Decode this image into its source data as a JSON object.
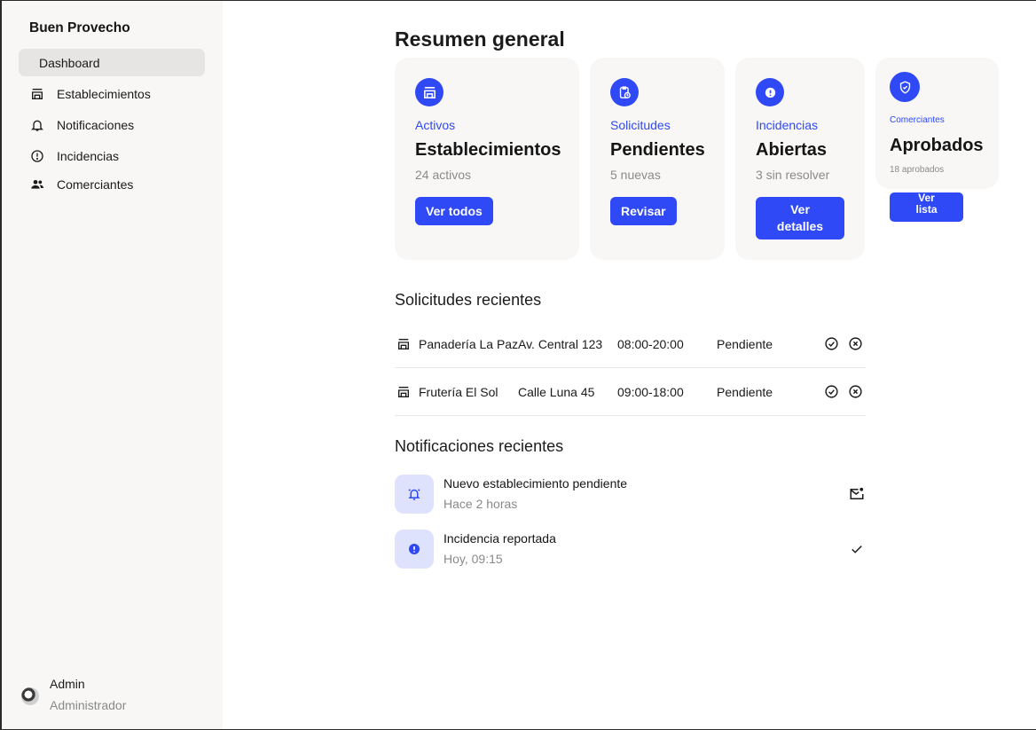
{
  "sidebar": {
    "brand": "Buen Provecho",
    "items": [
      {
        "label": "Dashboard",
        "icon": "none"
      },
      {
        "label": "Establecimientos",
        "icon": "storefront-icon"
      },
      {
        "label": "Notificaciones",
        "icon": "bell-icon"
      },
      {
        "label": "Incidencias",
        "icon": "alert-circle-icon"
      },
      {
        "label": "Comerciantes",
        "icon": "people-icon"
      }
    ],
    "user": {
      "name": "Admin",
      "role": "Administrador"
    }
  },
  "main": {
    "title": "Resumen general",
    "accent": "#2e49f5",
    "cards": [
      {
        "eyebrow": "Activos",
        "title": "Establecimientos",
        "sub": "24 activos",
        "button": "Ver todos",
        "icon": "storefront-icon"
      },
      {
        "eyebrow": "Solicitudes",
        "title": "Pendientes",
        "sub": "5 nuevas",
        "button": "Revisar",
        "icon": "clipboard-clock-icon"
      },
      {
        "eyebrow": "Incidencias",
        "title": "Abiertas",
        "sub": "3 sin resolver",
        "button_line1": "Ver",
        "button_line2": "detalles",
        "icon": "alert-icon"
      },
      {
        "eyebrow": "Comerciantes",
        "title": "Aprobados",
        "sub": "18 aprobados",
        "button_line1": "Ver",
        "button_line2": "lista",
        "icon": "shield-check-icon"
      }
    ],
    "requests": {
      "title": "Solicitudes recientes",
      "rows": [
        {
          "name": "Panadería La Paz",
          "address": "Av. Central 123",
          "hours": "08:00-20:00",
          "status": "Pendiente"
        },
        {
          "name": "Frutería El Sol",
          "address": "Calle Luna 45",
          "hours": "09:00-18:00",
          "status": "Pendiente"
        }
      ]
    },
    "notifications": {
      "title": "Notificaciones recientes",
      "items": [
        {
          "title": "Nuevo establecimiento pendiente",
          "time": "Hace 2 horas",
          "icon": "bell-ring-icon",
          "action_icon": "mail-unread-icon"
        },
        {
          "title": "Incidencia reportada",
          "time": "Hoy, 09:15",
          "icon": "alert-icon",
          "action_icon": "check-icon"
        }
      ]
    }
  }
}
